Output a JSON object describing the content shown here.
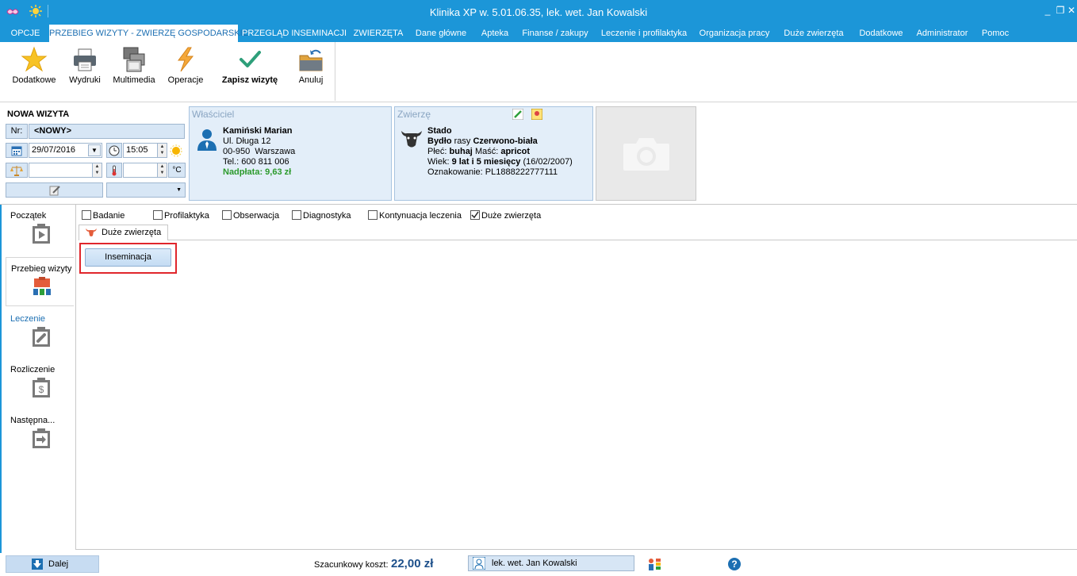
{
  "window": {
    "title": "Klinika XP w. 5.01.06.35, lek. wet. Jan Kowalski",
    "controls": {
      "minimize": "_",
      "restore": "❐",
      "close": "✕"
    }
  },
  "menu": {
    "items": [
      "OPCJE",
      "PRZEBIEG WIZYTY - ZWIERZĘ GOSPODARSKIE",
      "PRZEGLĄD INSEMINACJI",
      "ZWIERZĘTA",
      "Dane główne",
      "Apteka",
      "Finanse / zakupy",
      "Leczenie i profilaktyka",
      "Organizacja pracy",
      "Duże zwierzęta",
      "Dodatkowe",
      "Administrator",
      "Pomoc"
    ],
    "active_index": 1
  },
  "ribbon": {
    "dodatkowe": "Dodatkowe",
    "wydruki": "Wydruki",
    "multimedia": "Multimedia",
    "operacje": "Operacje",
    "zapisz": "Zapisz wizytę",
    "anuluj": "Anuluj"
  },
  "visit": {
    "header": "NOWA WIZYTA",
    "nr_label": "Nr:",
    "nr_value": "<NOWY>",
    "date": "29/07/2016",
    "time": "15:05",
    "temp_unit": "°C"
  },
  "owner": {
    "header": "Właściciel",
    "name": "Kamiński Marian",
    "street": "Ul. Długa 12",
    "city": "00-950  Warszawa",
    "phone": "Tel.: 600 811 006",
    "balance": "Nadpłata: 9,63 zł"
  },
  "animal": {
    "header": "Zwierzę",
    "name": "Stado",
    "species": "Bydło",
    "breed_prefix": "rasy",
    "breed": "Czerwono-biała",
    "sex_label": "Płeć:",
    "sex": "buhaj",
    "color_label": "Maść:",
    "color": "apricot",
    "age_label": "Wiek:",
    "age": "9 lat i 5 miesięcy",
    "birth": "(16/02/2007)",
    "tag_label": "Oznakowanie:",
    "tag": "PL1888222777111"
  },
  "sidebar": {
    "items": [
      "Początek",
      "Przebieg wizyty",
      "Leczenie",
      "Rozliczenie",
      "Następna..."
    ],
    "active_index": 1
  },
  "checkboxes": [
    {
      "label": "Badanie",
      "checked": false
    },
    {
      "label": "Profilaktyka",
      "checked": false
    },
    {
      "label": "Obserwacja",
      "checked": false
    },
    {
      "label": "Diagnostyka",
      "checked": false
    },
    {
      "label": "Kontynuacja leczenia",
      "checked": false
    },
    {
      "label": "Duże zwierzęta",
      "checked": true
    }
  ],
  "content_tab": "Duże zwierzęta",
  "insemination_button": "Inseminacja",
  "status": {
    "next_button": "Dalej",
    "cost_label": "Szacunkowy koszt:",
    "cost_value": "22,00 zł",
    "doctor": "lek. wet. Jan Kowalski",
    "help": "?"
  },
  "colors": {
    "accent": "#1c96d8",
    "panel_bg": "#e3eef9",
    "highlight_box": "#e0262c",
    "balance_green": "#2c9a2c"
  }
}
